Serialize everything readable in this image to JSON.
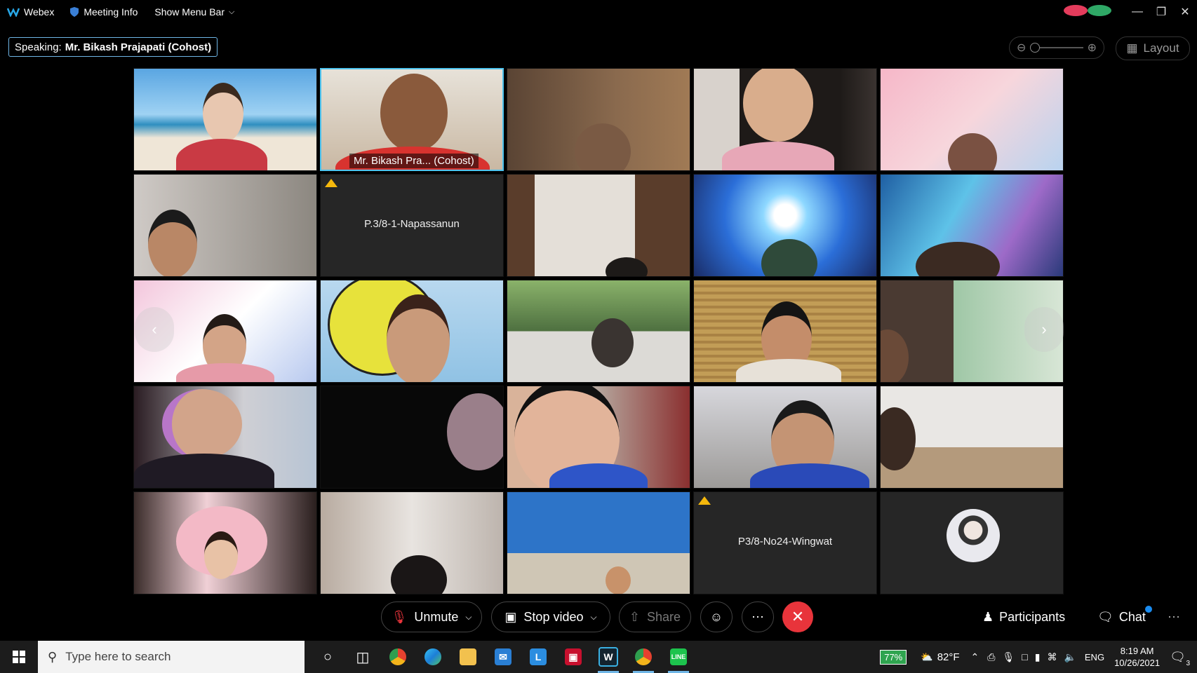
{
  "titlebar": {
    "app_name": "Webex",
    "meeting_info": "Meeting Info",
    "show_menu_bar": "Show Menu Bar"
  },
  "speaking": {
    "prefix": "Speaking:",
    "name": "Mr. Bikash Prajapati (Cohost)"
  },
  "layout_label": "Layout",
  "tiles": [
    {
      "kind": "video",
      "scene": "beach"
    },
    {
      "kind": "video",
      "scene": "office",
      "label": "Mr. Bikash Pra...  (Cohost)",
      "active": true
    },
    {
      "kind": "video",
      "scene": "shelf"
    },
    {
      "kind": "video",
      "scene": "girl"
    },
    {
      "kind": "video",
      "scene": "clouds"
    },
    {
      "kind": "video",
      "scene": "boy-blur"
    },
    {
      "kind": "name",
      "name": "P.3/8-1-Napassanun",
      "warning": true
    },
    {
      "kind": "video",
      "scene": "curtain"
    },
    {
      "kind": "video",
      "scene": "anime"
    },
    {
      "kind": "video",
      "scene": "anime2"
    },
    {
      "kind": "video",
      "scene": "pink"
    },
    {
      "kind": "video",
      "scene": "turtle"
    },
    {
      "kind": "video",
      "scene": "trees"
    },
    {
      "kind": "video",
      "scene": "blinds"
    },
    {
      "kind": "video",
      "scene": "wallpaper"
    },
    {
      "kind": "video",
      "scene": "headphones"
    },
    {
      "kind": "video",
      "scene": "dark"
    },
    {
      "kind": "video",
      "scene": "glasses"
    },
    {
      "kind": "video",
      "scene": "blur-boy"
    },
    {
      "kind": "video",
      "scene": "room"
    },
    {
      "kind": "video",
      "scene": "chair"
    },
    {
      "kind": "video",
      "scene": "wall"
    },
    {
      "kind": "video",
      "scene": "blue-room"
    },
    {
      "kind": "name",
      "name": "P3/8-No24-Wingwat",
      "warning": true
    },
    {
      "kind": "avatar"
    }
  ],
  "controls": {
    "unmute": "Unmute",
    "stop_video": "Stop video",
    "share": "Share",
    "participants": "Participants",
    "chat": "Chat"
  },
  "taskbar": {
    "search_placeholder": "Type here to search",
    "battery": "77%",
    "temperature": "82°F",
    "language": "ENG",
    "time": "8:19 AM",
    "date": "10/26/2021",
    "notification_count": "3"
  },
  "colors": {
    "accent": "#4ec3ee",
    "end_call": "#e8343b",
    "warning": "#f5b80c"
  }
}
